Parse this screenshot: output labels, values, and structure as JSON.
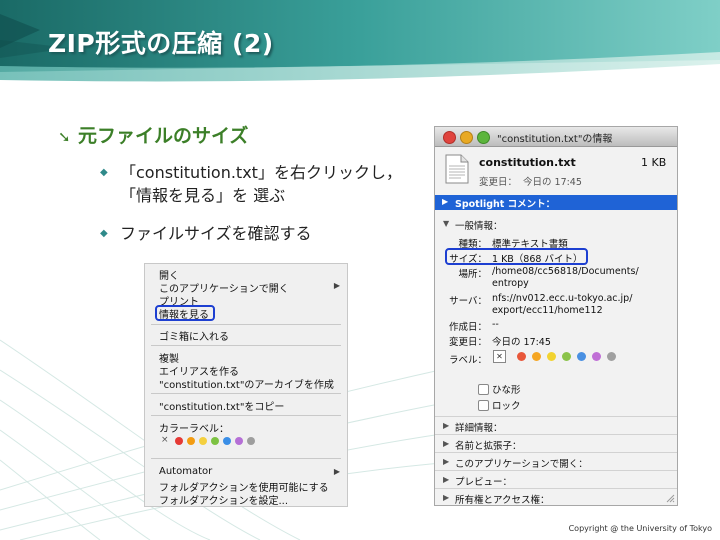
{
  "slide": {
    "title": "ZIP形式の圧縮 (2)",
    "heading": "元ファイルのサイズ",
    "heading_marker": "➘",
    "bullets": [
      {
        "line1": "「constitution.txt」を右クリックし，",
        "line2": "「情報を見る」を 選ぶ"
      },
      {
        "line1": "ファイルサイズを確認する",
        "line2": ""
      }
    ],
    "bullet_marker": "◆",
    "footer": "Copyright @ the University of Tokyo"
  },
  "context_menu": {
    "items": [
      "開く",
      "このアプリケーションで開く",
      "プリント",
      "情報を見る",
      "ゴミ箱に入れる",
      "複製",
      "エイリアスを作る",
      "\"constitution.txt\"のアーカイブを作成",
      "\"constitution.txt\"をコピー",
      "カラーラベル：",
      "Automator",
      "フォルダアクションを使用可能にする",
      "フォルダアクションを設定..."
    ],
    "submenu_glyph": "▶",
    "clear_label_glyph": "×",
    "label_colors": [
      "#e53935",
      "#f39c12",
      "#f4d03f",
      "#7dc242",
      "#3a8ee6",
      "#b56fd6",
      "#9e9e9e"
    ]
  },
  "info_window": {
    "title": "\"constitution.txt\"の情報",
    "file_name": "constitution.txt",
    "file_size": "1 KB",
    "modified_label": "変更日：",
    "modified_value": "今日の 17:45",
    "spotlight": "Spotlight コメント：",
    "general": "一般情報：",
    "fields": {
      "kind_label": "種類：",
      "kind_value": "標準テキスト書類",
      "size_label": "サイズ：",
      "size_value": "1 KB（868 バイト）",
      "where_label": "場所：",
      "where_value1": "/home08/cc56818/Documents/",
      "where_value2": "entropy",
      "server_label": "サーバ：",
      "server_value1": "nfs://nv012.ecc.u-tokyo.ac.jp/",
      "server_value2": "export/ecc11/home112",
      "created_label": "作成日：",
      "created_value": "--",
      "modified_label": "変更日：",
      "modified_value": "今日の 17:45",
      "label_label": "ラベル："
    },
    "label_colors": [
      "#e8573a",
      "#f5a623",
      "#f2d330",
      "#8bc34a",
      "#4a90e2",
      "#c06fd6",
      "#a0a0a0"
    ],
    "stationery": "ひな形",
    "locked": "ロック",
    "sections": [
      "詳細情報：",
      "名前と拡張子：",
      "このアプリケーションで開く：",
      "プレビュー：",
      "所有権とアクセス権："
    ],
    "expanded_glyph": "▼",
    "collapsed_glyph": "▶",
    "clear_label_glyph": "✕"
  }
}
